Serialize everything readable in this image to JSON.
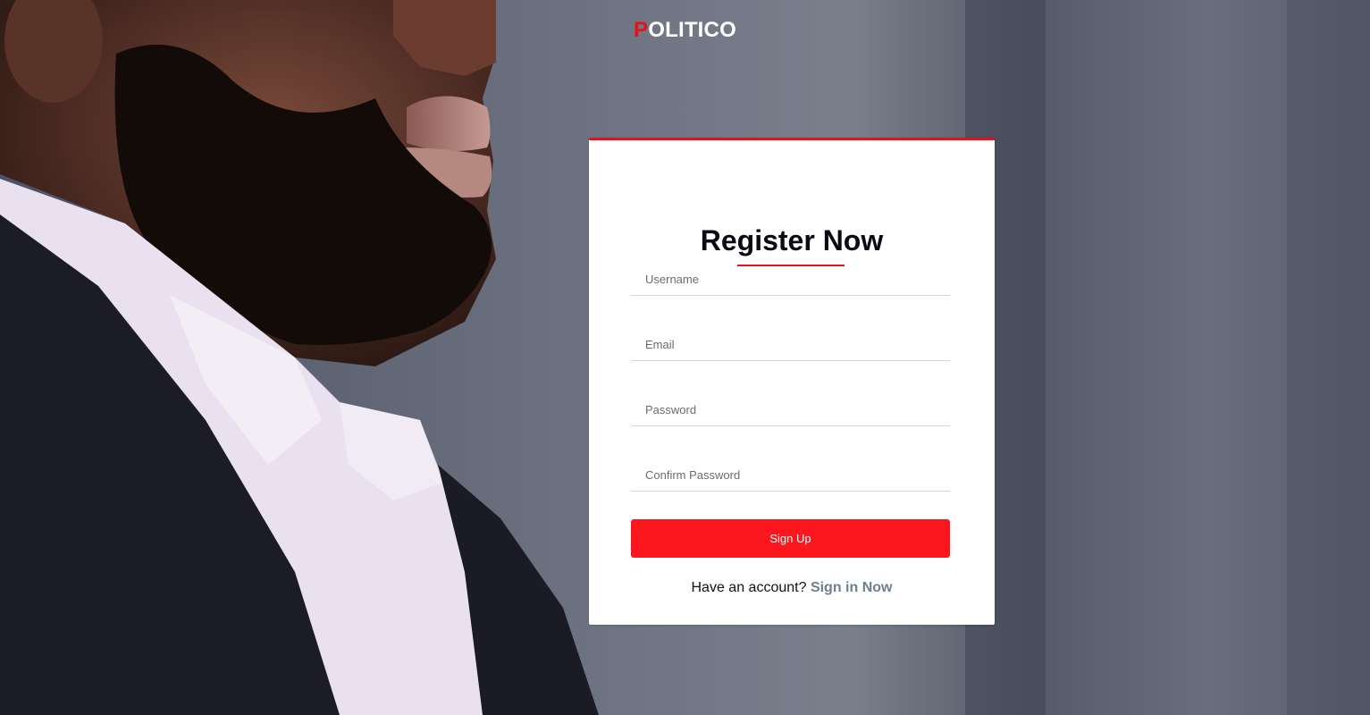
{
  "brand": {
    "first_letter": "P",
    "rest": "OLITICO",
    "accent_color": "#e8101b"
  },
  "form": {
    "title": "Register Now",
    "fields": {
      "username_placeholder": "Username",
      "email_placeholder": "Email",
      "password_placeholder": "Password",
      "confirm_password_placeholder": "Confirm Password"
    },
    "submit_label": "Sign Up",
    "footer_prompt": "Have an account?",
    "footer_link": "Sign in Now"
  },
  "colors": {
    "primary_red": "#fb171d",
    "link_gray": "#6d7f91"
  }
}
